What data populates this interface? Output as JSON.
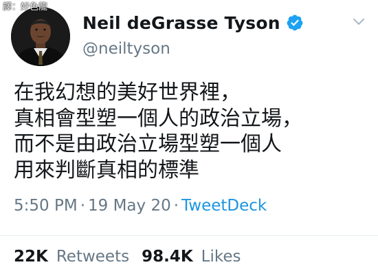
{
  "watermark": "譯：好色龍",
  "user": {
    "display_name": "Neil deGrasse Tyson",
    "handle": "@neiltyson",
    "verified": true
  },
  "tweet": {
    "lines": [
      "在我幻想的美好世界裡，",
      "真相會型塑一個人的政治立場，",
      "而不是由政治立場型塑一個人",
      "用來判斷真相的標準"
    ]
  },
  "meta": {
    "time": "5:50 PM",
    "separator": "·",
    "date": "19 May 20",
    "source": "TweetDeck"
  },
  "stats": {
    "retweets_count": "22K",
    "retweets_label": "Retweets",
    "likes_count": "98.4K",
    "likes_label": "Likes"
  },
  "colors": {
    "verified": "#1da1f2",
    "link": "#1b95e0",
    "secondary_text": "#657786"
  },
  "icons": {
    "verified": "verified-badge-icon",
    "menu": "chevron-down-icon"
  }
}
